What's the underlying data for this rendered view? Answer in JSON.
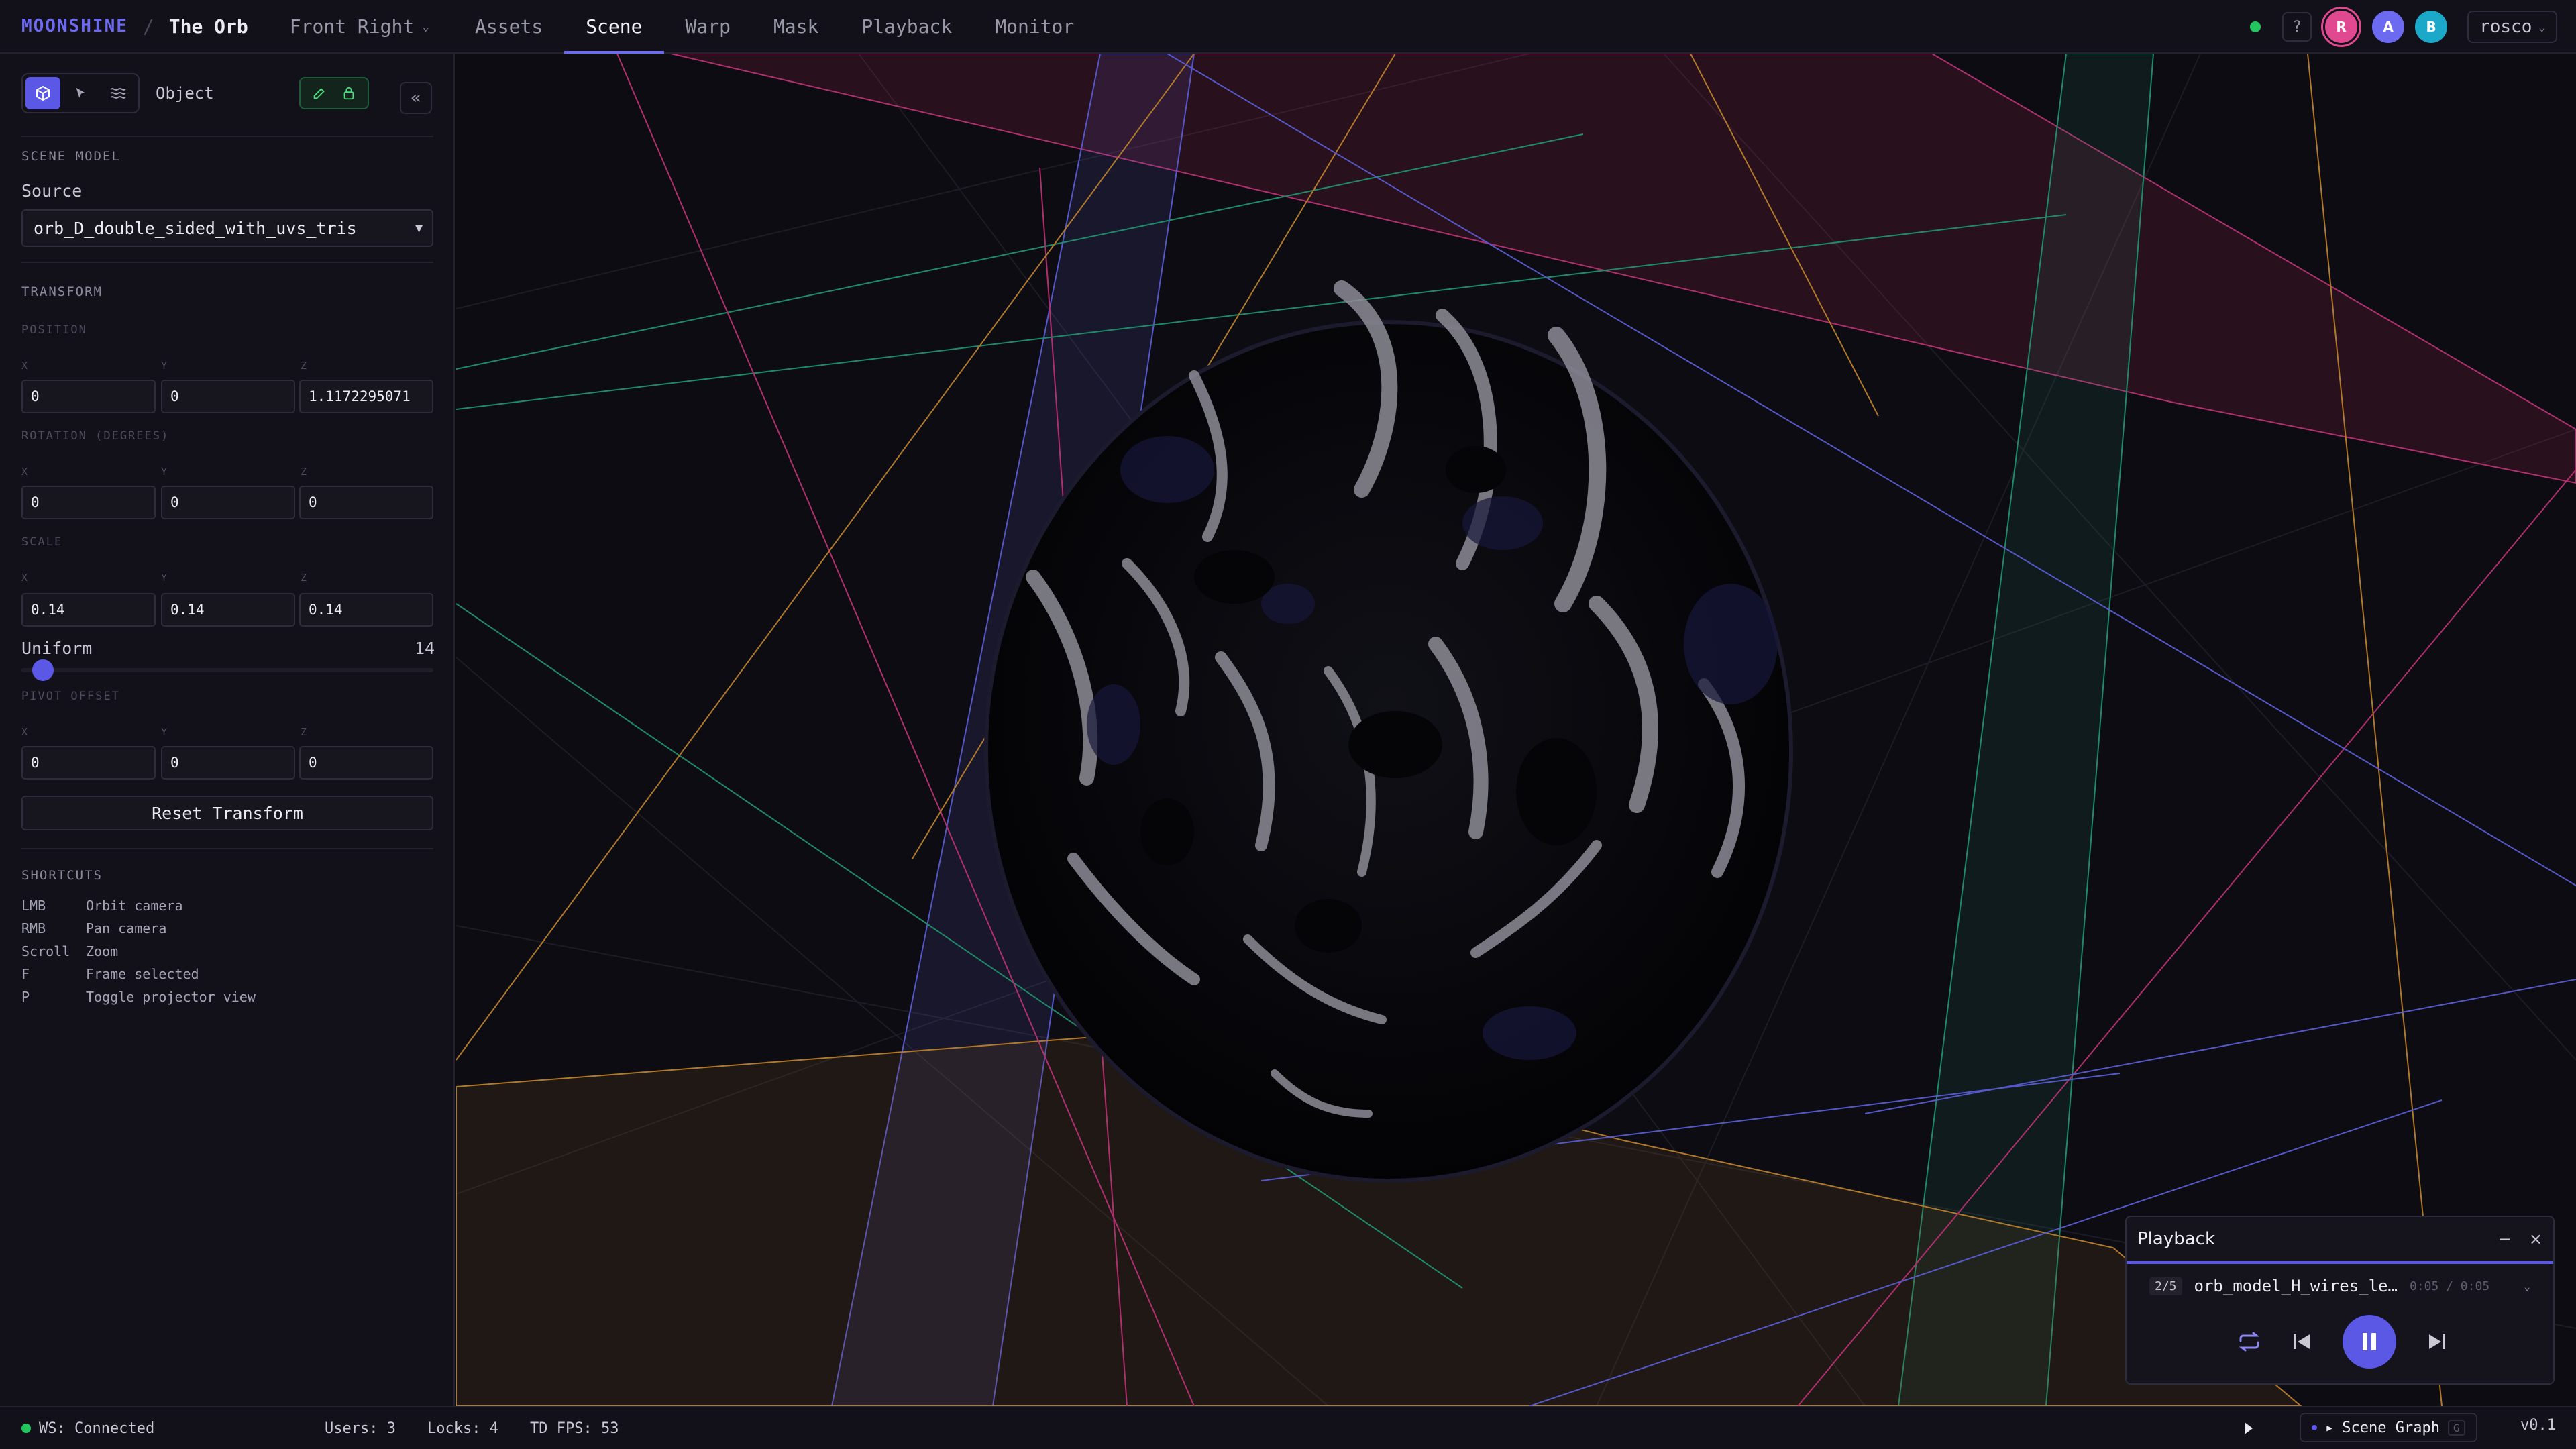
{
  "app": {
    "brand": "MOONSHINE",
    "separator": "/",
    "project": "The Orb",
    "view": "Front Right"
  },
  "nav": {
    "tabs": [
      "Assets",
      "Scene",
      "Warp",
      "Mask",
      "Playback",
      "Monitor"
    ],
    "active": "Scene"
  },
  "header": {
    "help": "?",
    "avatars": [
      "R",
      "A",
      "B"
    ],
    "user": "rosco"
  },
  "sidebar": {
    "mode_label": "Object",
    "collapse": "«",
    "scene_model": {
      "title": "SCENE MODEL",
      "source_label": "Source",
      "source_value": "orb_D_double_sided_with_uvs_tris"
    },
    "transform": {
      "title": "TRANSFORM",
      "axes": [
        "X",
        "Y",
        "Z"
      ],
      "position": {
        "label": "POSITION",
        "x": "0",
        "y": "0",
        "z": "1.1172295071"
      },
      "rotation": {
        "label": "ROTATION (DEGREES)",
        "x": "0",
        "y": "0",
        "z": "0"
      },
      "scale": {
        "label": "SCALE",
        "x": "0.14",
        "y": "0.14",
        "z": "0.14"
      },
      "uniform": {
        "label": "Uniform",
        "value": "14"
      },
      "pivot": {
        "label": "PIVOT OFFSET",
        "x": "0",
        "y": "0",
        "z": "0"
      },
      "reset_label": "Reset Transform"
    },
    "shortcuts": {
      "title": "SHORTCUTS",
      "items": [
        {
          "key": "LMB",
          "action": "Orbit camera"
        },
        {
          "key": "RMB",
          "action": "Pan camera"
        },
        {
          "key": "Scroll",
          "action": "Zoom"
        },
        {
          "key": "F",
          "action": "Frame selected"
        },
        {
          "key": "P",
          "action": "Toggle projector view"
        }
      ]
    }
  },
  "playback": {
    "title": "Playback",
    "minimize": "−",
    "close": "×",
    "position": "2/5",
    "track": "orb_model_H_wires_le…",
    "time": "0:05 / 0:05"
  },
  "status": {
    "ws": "WS: Connected",
    "users": "Users: 3",
    "locks": "Locks: 4",
    "fps": "TD FPS: 53",
    "scene_graph": "Scene Graph",
    "scene_graph_badge": "G",
    "version": "v0.1"
  },
  "colors": {
    "accent": "#6d6af2",
    "connected": "#22c55e",
    "edit": "#4ade80"
  }
}
